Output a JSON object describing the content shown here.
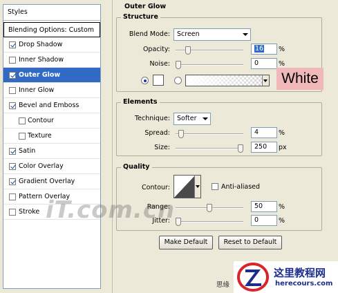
{
  "styles_panel": {
    "header": "Styles",
    "blending_options": "Blending Options: Custom",
    "items": [
      {
        "label": "Drop Shadow",
        "checked": true,
        "sub": false,
        "active": false
      },
      {
        "label": "Inner Shadow",
        "checked": false,
        "sub": false,
        "active": false
      },
      {
        "label": "Outer Glow",
        "checked": true,
        "sub": false,
        "active": true
      },
      {
        "label": "Inner Glow",
        "checked": false,
        "sub": false,
        "active": false
      },
      {
        "label": "Bevel and Emboss",
        "checked": true,
        "sub": false,
        "active": false
      },
      {
        "label": "Contour",
        "checked": false,
        "sub": true,
        "active": false
      },
      {
        "label": "Texture",
        "checked": false,
        "sub": true,
        "active": false
      },
      {
        "label": "Satin",
        "checked": true,
        "sub": false,
        "active": false
      },
      {
        "label": "Color Overlay",
        "checked": true,
        "sub": false,
        "active": false
      },
      {
        "label": "Gradient Overlay",
        "checked": true,
        "sub": false,
        "active": false
      },
      {
        "label": "Pattern Overlay",
        "checked": false,
        "sub": false,
        "active": false
      },
      {
        "label": "Stroke",
        "checked": false,
        "sub": false,
        "active": false
      }
    ]
  },
  "outer_glow": {
    "title": "Outer Glow",
    "structure": {
      "legend": "Structure",
      "blend_mode_label": "Blend Mode:",
      "blend_mode_value": "Screen",
      "opacity_label": "Opacity:",
      "opacity_value": "16",
      "opacity_fraction": 0.16,
      "noise_label": "Noise:",
      "noise_value": "0",
      "noise_fraction": 0.0,
      "unit": "%",
      "color_mode": "solid",
      "swatch_color": "#ffffff",
      "color_note": "White"
    },
    "elements": {
      "legend": "Elements",
      "technique_label": "Technique:",
      "technique_value": "Softer",
      "spread_label": "Spread:",
      "spread_value": "4",
      "spread_fraction": 0.04,
      "spread_unit": "%",
      "size_label": "Size:",
      "size_value": "250",
      "size_fraction": 1.0,
      "size_unit": "px"
    },
    "quality": {
      "legend": "Quality",
      "contour_label": "Contour:",
      "anti_aliased_label": "Anti-aliased",
      "anti_aliased_checked": false,
      "range_label": "Range:",
      "range_value": "50",
      "range_fraction": 0.5,
      "range_unit": "%",
      "jitter_label": "Jitter:",
      "jitter_value": "0",
      "jitter_fraction": 0.0,
      "jitter_unit": "%"
    },
    "make_default_label": "Make Default",
    "reset_default_label": "Reset to Default"
  },
  "watermark": "iT.com.cn",
  "logo": {
    "cn_text": "这里教程网",
    "url_text": "herecours.com",
    "brand_color": "#1c2d8c",
    "accent_color": "#d9242a"
  },
  "footer_cn": "思缘"
}
